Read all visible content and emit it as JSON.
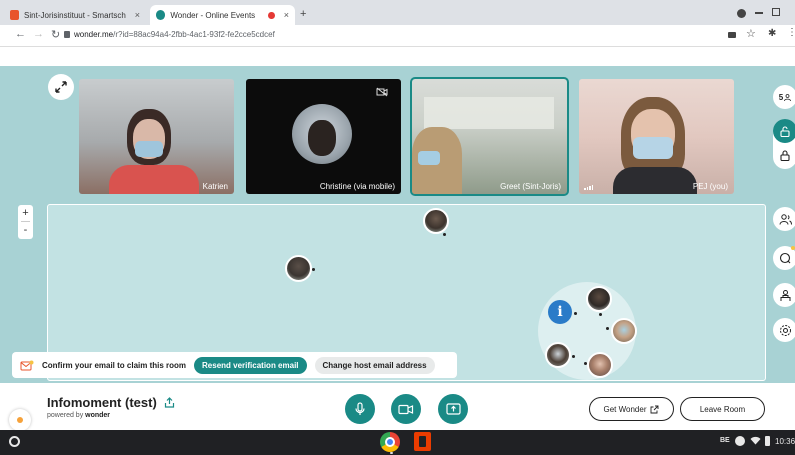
{
  "browser": {
    "tabs": [
      {
        "title": "Sint-Jorisinstituut - Smartschool",
        "favicon_color": "#e8542c",
        "close": "×"
      },
      {
        "title": "Wonder - Online Events",
        "favicon_color": "#1a8a86",
        "close": "×"
      }
    ],
    "recording_close": "×",
    "new_tab": "+",
    "url_host": "wonder.me",
    "url_rest": "/r?id=88ac94a4-2fbb-4ac1-93f2-fe2cce5cdcef"
  },
  "participants": [
    {
      "name": "Katrien"
    },
    {
      "name": "Christine (via mobile)"
    },
    {
      "name": "Greet (Sint-Joris)"
    },
    {
      "name": "PEJ (you)"
    }
  ],
  "sidebar": {
    "participant_count": "5"
  },
  "zoom": {
    "plus": "+",
    "minus": "-"
  },
  "confirm_bar": {
    "message": "Confirm your email to claim this room",
    "resend_label": "Resend verification email",
    "change_label": "Change host email address"
  },
  "room": {
    "title": "Infomoment (test)",
    "powered_prefix": "powered by ",
    "powered_brand": "wonder"
  },
  "bottom_actions": {
    "get_wonder_label": "Get Wonder",
    "leave_label": "Leave Room"
  },
  "taskbar": {
    "locale": "BE",
    "time": "10:36"
  },
  "colors": {
    "accent": "#1a8a86",
    "canvas": "#a8d2d4",
    "room_area": "#c2e2e3",
    "info_bubble": "#2a7bc8"
  },
  "icons": [
    "expand-icon",
    "camera-off-icon",
    "people-icon",
    "lock-icon",
    "chat-icon",
    "broadcast-icon",
    "settings-icon",
    "mic-icon",
    "video-icon",
    "screenshare-icon",
    "share-icon",
    "chrome-icon",
    "office-icon",
    "wifi-icon",
    "battery-icon"
  ]
}
